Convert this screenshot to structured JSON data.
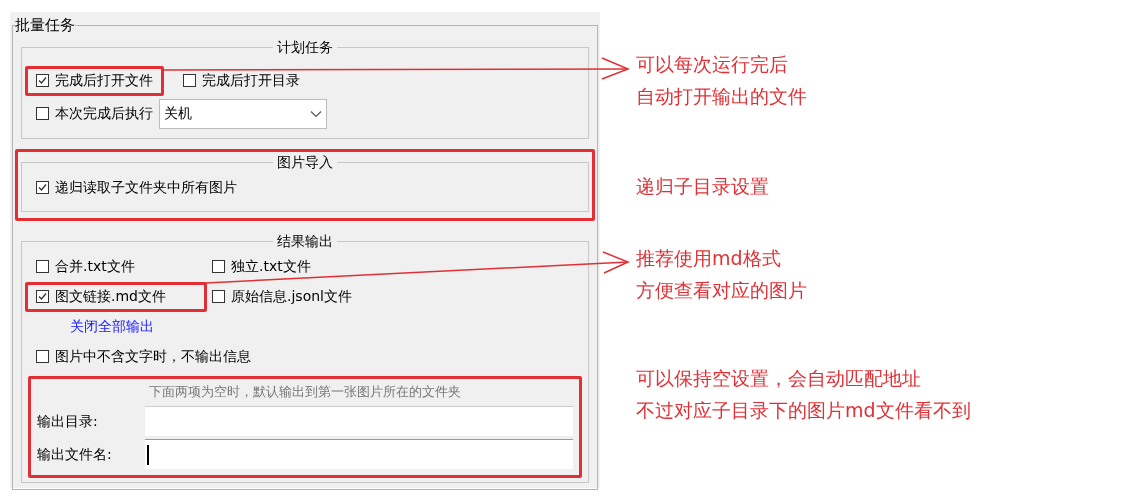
{
  "group": {
    "title": "批量任务",
    "schedule": {
      "title": "计划任务",
      "options": [
        {
          "label": "完成后打开文件",
          "checked": true,
          "highlighted": true
        },
        {
          "label": "完成后打开目录",
          "checked": false,
          "highlighted": false
        }
      ],
      "after_run": {
        "label": "本次完成后执行",
        "checked": false,
        "value": "关机"
      }
    },
    "import": {
      "title": "图片导入",
      "highlighted": true,
      "options": [
        {
          "label": "递归读取子文件夹中所有图片",
          "checked": true
        }
      ]
    },
    "output": {
      "title": "结果输出",
      "options": [
        {
          "label": "合并.txt文件",
          "checked": false,
          "highlighted": false
        },
        {
          "label": "独立.txt文件",
          "checked": false,
          "highlighted": false
        },
        {
          "label": "图文链接.md文件",
          "checked": true,
          "highlighted": true
        },
        {
          "label": "原始信息.jsonl文件",
          "checked": false,
          "highlighted": false
        }
      ],
      "link": "关闭全部输出",
      "skip_empty": {
        "label": "图片中不含文字时，不输出信息",
        "checked": false
      },
      "paths": {
        "highlighted": true,
        "hint": "下面两项为空时，默认输出到第一张图片所在的文件夹",
        "fields": [
          {
            "label": "输出目录:",
            "focused": false
          },
          {
            "label": "输出文件名:",
            "focused": true
          }
        ]
      }
    }
  },
  "annotations": [
    {
      "lines": [
        "可以每次运行完后",
        "自动打开输出的文件"
      ],
      "arrow": true
    },
    {
      "lines": [
        "递归子目录设置"
      ],
      "arrow": false
    },
    {
      "lines": [
        "推荐使用md格式",
        "方便查看对应的图片"
      ],
      "arrow": true
    },
    {
      "lines": [
        "可以保持空设置，会自动匹配地址",
        "不过对应子目录下的图片md文件看不到"
      ],
      "arrow": false
    }
  ]
}
